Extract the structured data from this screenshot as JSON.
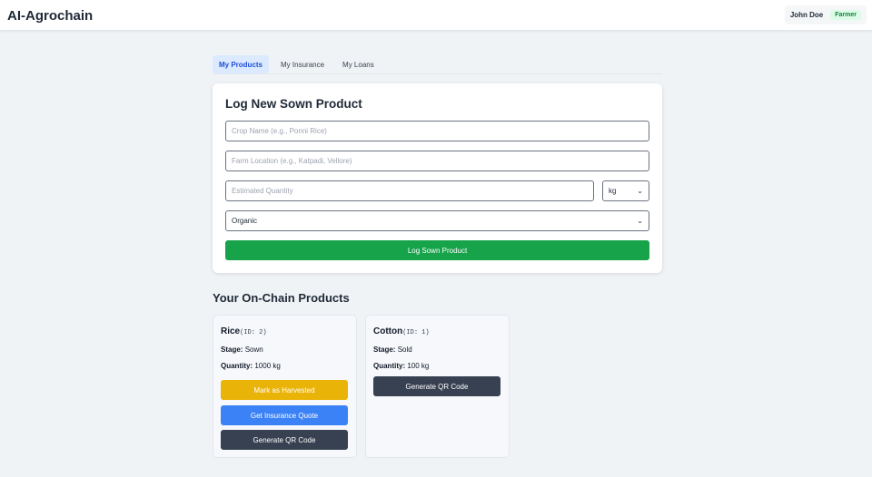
{
  "header": {
    "brand": "AI-Agrochain",
    "user_name": "John Doe",
    "user_role": "Farmer"
  },
  "tabs": [
    {
      "label": "My Products",
      "active": true
    },
    {
      "label": "My Insurance",
      "active": false
    },
    {
      "label": "My Loans",
      "active": false
    }
  ],
  "form": {
    "title": "Log New Sown Product",
    "crop_placeholder": "Crop Name (e.g., Ponni Rice)",
    "location_placeholder": "Farm Location (e.g., Katpadi, Vellore)",
    "quantity_placeholder": "Estimated Quantity",
    "unit_value": "kg",
    "type_value": "Organic",
    "submit_label": "Log Sown Product"
  },
  "products_section": {
    "title": "Your On-Chain Products"
  },
  "products": [
    {
      "name": "Rice",
      "id": "(ID: 2)",
      "stage_label": "Stage:",
      "stage": "Sown",
      "quantity_label": "Quantity:",
      "quantity": "1000 kg",
      "harvest_label": "Mark as Harvested",
      "insurance_label": "Get Insurance Quote",
      "qr_label": "Generate QR Code"
    },
    {
      "name": "Cotton",
      "id": "(ID: 1)",
      "stage_label": "Stage:",
      "stage": "Sold",
      "quantity_label": "Quantity:",
      "quantity": "100 kg",
      "qr_label": "Generate QR Code"
    }
  ],
  "icons": {
    "select_chevron": "chevron-down-icon"
  },
  "colors": {
    "primary_green": "#16a34a",
    "warning_yellow": "#eab308",
    "accent_blue": "#3b82f6",
    "dark_slate": "#374151"
  }
}
